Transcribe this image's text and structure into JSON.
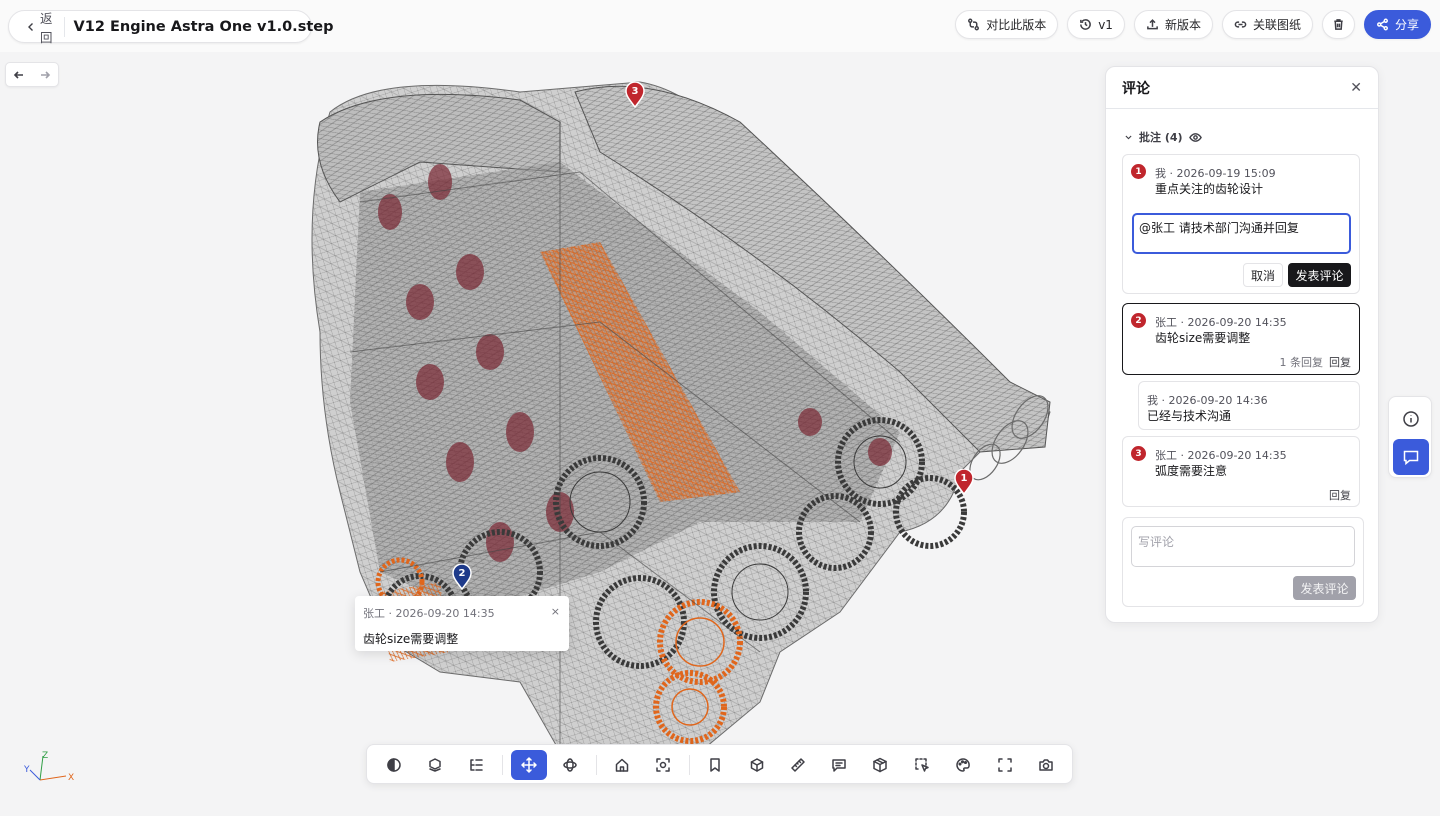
{
  "header": {
    "back_label": "返回",
    "doc_title": "V12 Engine Astra One v1.0.step",
    "actions": {
      "compare": "对比此版本",
      "version": "v1",
      "new_version": "新版本",
      "link_drawing": "关联图纸",
      "share": "分享"
    }
  },
  "viewport": {
    "pins": [
      {
        "label": "1",
        "color": "#c0262d"
      },
      {
        "label": "2",
        "color": "#1e3a8a"
      },
      {
        "label": "3",
        "color": "#c0262d"
      }
    ],
    "popover": {
      "meta": "张工 · 2026-09-20 14:35",
      "text": "齿轮size需要调整",
      "close": "×"
    },
    "axes": {
      "x": "X",
      "y": "Y",
      "z": "Z"
    }
  },
  "toolbar": {
    "icons": [
      "section-icon",
      "explode-icon",
      "tree-icon",
      "move-icon",
      "rotate-icon",
      "home-icon",
      "fit-icon",
      "bookmark-icon",
      "view-cube-icon",
      "measure-icon",
      "annotation-icon",
      "component-icon",
      "box-select-icon",
      "palette-icon",
      "fullscreen-icon",
      "camera-icon"
    ],
    "active": "move-icon"
  },
  "comments": {
    "title": "评论",
    "group_label": "批注 (4)",
    "items": [
      {
        "badge": "1",
        "meta": "我 · 2026-09-19 15:09",
        "text": "重点关注的齿轮设计",
        "reply_draft": "@张工 请技术部门沟通并回复",
        "cancel": "取消",
        "post": "发表评论"
      },
      {
        "badge": "2",
        "meta": "张工 · 2026-09-20 14:35",
        "text": "齿轮size需要调整",
        "reply_count": "1 条回复",
        "reply": "回复"
      },
      {
        "meta": "我 · 2026-09-20 14:36",
        "text": "已经与技术沟通"
      },
      {
        "badge": "3",
        "meta": "张工 · 2026-09-20 14:35",
        "text": "弧度需要注意",
        "reply": "回复"
      }
    ],
    "new_placeholder": "写评论",
    "new_post": "发表评论"
  },
  "colors": {
    "accent": "#3b5bdb",
    "pin_red": "#c0262d",
    "pin_blue": "#1e3a8a",
    "engine_orange": "#e0661c"
  }
}
